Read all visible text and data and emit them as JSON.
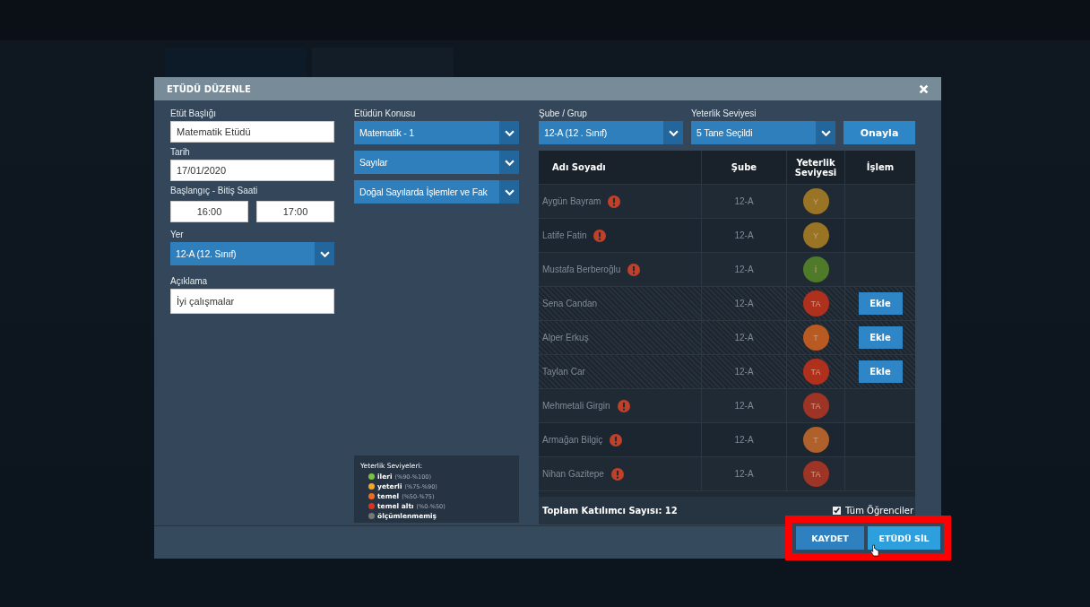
{
  "dialog": {
    "title": "ETÜDÜ DÜZENLE"
  },
  "form": {
    "title_label": "Etüt Başlığı",
    "title_value": "Matematik Etüdü",
    "date_label": "Tarih",
    "date_value": "17/01/2020",
    "time_label": "Başlangıç - Bitiş Saati",
    "start_value": "16:00",
    "end_value": "17:00",
    "place_label": "Yer",
    "place_value": "12-A (12. Sınıf)",
    "note_label": "Açıklama",
    "note_value": "İyi çalışmalar"
  },
  "topic": {
    "label": "Etüdün Konusu",
    "selects": [
      "Matematik - 1",
      "Sayılar",
      "Doğal Sayılarda İşlemler ve Fak"
    ]
  },
  "legend": {
    "title": "Yeterlik Seviyeleri:",
    "items": [
      {
        "label": "ileri",
        "range": "(%90-%100)",
        "color": "#7ac143"
      },
      {
        "label": "yeterli",
        "range": "(%75-%90)",
        "color": "#f5a623"
      },
      {
        "label": "temel",
        "range": "(%50-%75)",
        "color": "#f26b1d"
      },
      {
        "label": "temel altı",
        "range": "(%0-%50)",
        "color": "#e0301e"
      },
      {
        "label": "ölçümlenmemiş",
        "color": "#777777"
      }
    ]
  },
  "filters": {
    "group_label": "Şube / Grup",
    "group_value": "12-A (12 . Sınıf)",
    "level_label": "Yeterlik Seviyesi",
    "level_value": "5 Tane Seçildi",
    "confirm": "Onayla"
  },
  "table": {
    "columns": [
      "Adı Soyadı",
      "Şube",
      "Yeterlik Seviyesi",
      "İşlem"
    ],
    "rows": [
      {
        "name": "Aygün Bayram",
        "warning": true,
        "branch": "12-A",
        "grade": "Y",
        "color": "#9a7425",
        "action": ""
      },
      {
        "name": "Latife Fatin",
        "warning": true,
        "branch": "12-A",
        "grade": "Y",
        "color": "#9a7425",
        "action": ""
      },
      {
        "name": "Mustafa Berberoğlu",
        "warning": true,
        "branch": "12-A",
        "grade": "İ",
        "color": "#4f7a2a",
        "action": ""
      },
      {
        "name": "Sena Candan",
        "warning": false,
        "branch": "12-A",
        "grade": "TA",
        "color": "#b0301e",
        "action": "Ekle"
      },
      {
        "name": "Alper Erkuş",
        "warning": false,
        "branch": "12-A",
        "grade": "T",
        "color": "#b85a22",
        "action": "Ekle"
      },
      {
        "name": "Taylan Car",
        "warning": false,
        "branch": "12-A",
        "grade": "TA",
        "color": "#b0301e",
        "action": "Ekle"
      },
      {
        "name": "Mehmetali Girgin",
        "warning": true,
        "branch": "12-A",
        "grade": "TA",
        "color": "#9e3426",
        "action": ""
      },
      {
        "name": "Armağan Bilgiç",
        "warning": true,
        "branch": "12-A",
        "grade": "T",
        "color": "#b0602a",
        "action": ""
      },
      {
        "name": "Nihan Gazitepe",
        "warning": true,
        "branch": "12-A",
        "grade": "TA",
        "color": "#9e3426",
        "action": ""
      }
    ],
    "total": "Toplam Katılımcı Sayısı: 12",
    "all_students": {
      "label": "Tüm Öğrenciler",
      "checked": true
    }
  },
  "buttons": [
    "KAYDET",
    "ETÜDÜ SİL"
  ]
}
